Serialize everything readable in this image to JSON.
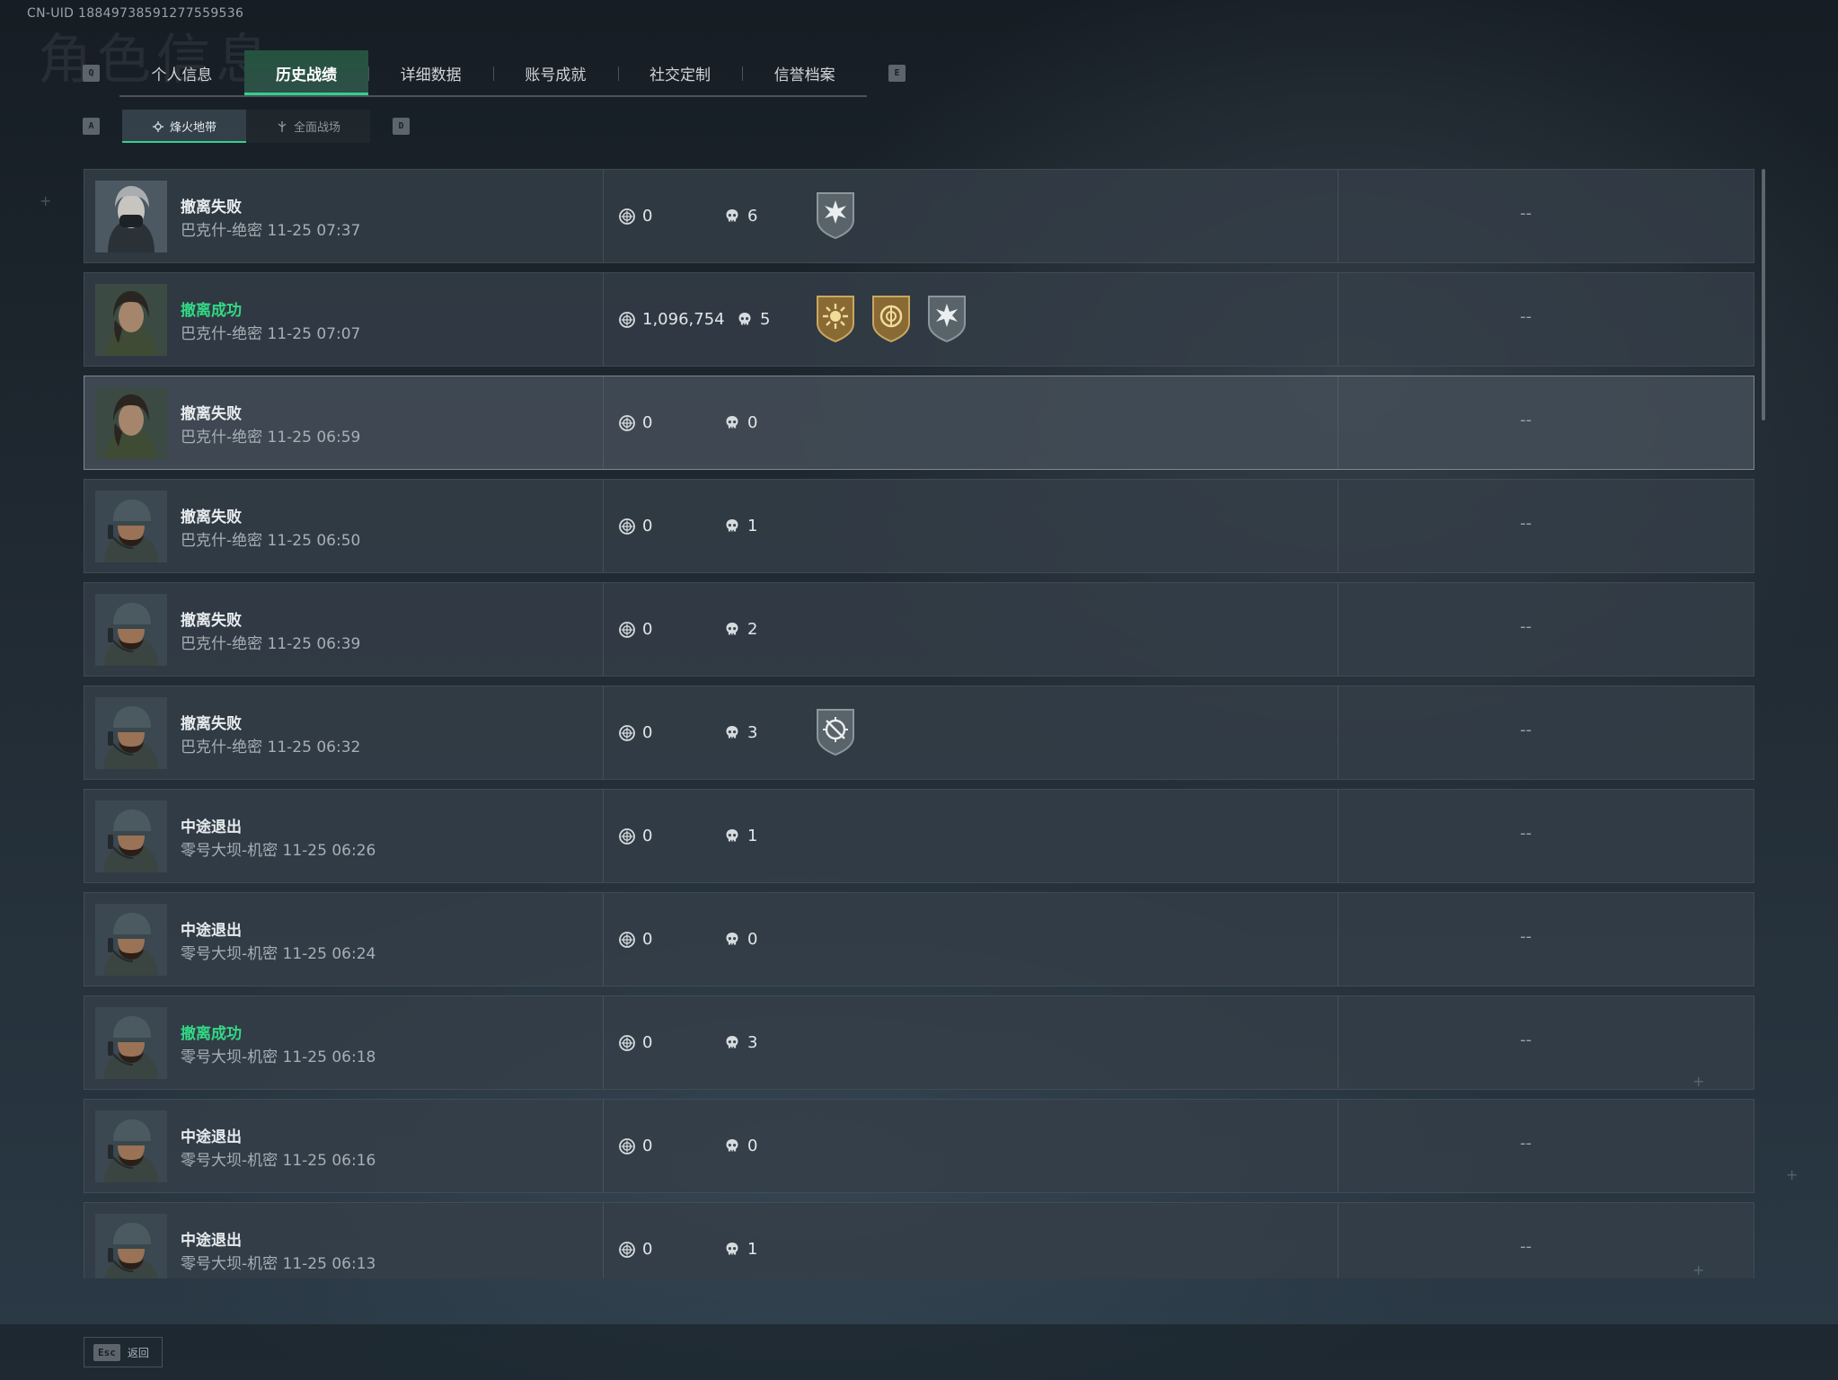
{
  "uid": "CN-UID 18849738591277559536",
  "page_title": "角色信息",
  "keys": {
    "prev_tab": "Q",
    "next_tab": "E",
    "prev_sub": "A",
    "next_sub": "D"
  },
  "tabs": [
    {
      "label": "个人信息",
      "active": false
    },
    {
      "label": "历史战绩",
      "active": true
    },
    {
      "label": "详细数据",
      "active": false
    },
    {
      "label": "账号成就",
      "active": false
    },
    {
      "label": "社交定制",
      "active": false
    },
    {
      "label": "信誉档案",
      "active": false
    }
  ],
  "subtabs": [
    {
      "label": "烽火地带",
      "icon": "flame-mode-icon",
      "active": true
    },
    {
      "label": "全面战场",
      "icon": "battlefield-mode-icon",
      "active": false
    }
  ],
  "matches": [
    {
      "result": "撤离失败",
      "success": false,
      "detail": "巴克什-绝密 11-25 07:37",
      "value": "0",
      "kills": "6",
      "badges": [
        "gray-star"
      ],
      "extra": "--",
      "avatar": "female-masked"
    },
    {
      "result": "撤离成功",
      "success": true,
      "detail": "巴克什-绝密 11-25 07:07",
      "value": "1,096,754",
      "kills": "5",
      "badges": [
        "gold-sun",
        "gold-coin",
        "gray-star"
      ],
      "extra": "--",
      "avatar": "female-dark"
    },
    {
      "result": "撤离失败",
      "success": false,
      "detail": "巴克什-绝密 11-25 06:59",
      "value": "0",
      "kills": "0",
      "badges": [],
      "extra": "--",
      "avatar": "female-dark"
    },
    {
      "result": "撤离失败",
      "success": false,
      "detail": "巴克什-绝密 11-25 06:50",
      "value": "0",
      "kills": "1",
      "badges": [],
      "extra": "--",
      "avatar": "male-cap"
    },
    {
      "result": "撤离失败",
      "success": false,
      "detail": "巴克什-绝密 11-25 06:39",
      "value": "0",
      "kills": "2",
      "badges": [],
      "extra": "--",
      "avatar": "male-cap"
    },
    {
      "result": "撤离失败",
      "success": false,
      "detail": "巴克什-绝密 11-25 06:32",
      "value": "0",
      "kills": "3",
      "badges": [
        "gray-target"
      ],
      "extra": "--",
      "avatar": "male-cap"
    },
    {
      "result": "中途退出",
      "success": false,
      "detail": "零号大坝-机密 11-25 06:26",
      "value": "0",
      "kills": "1",
      "badges": [],
      "extra": "--",
      "avatar": "male-cap"
    },
    {
      "result": "中途退出",
      "success": false,
      "detail": "零号大坝-机密 11-25 06:24",
      "value": "0",
      "kills": "0",
      "badges": [],
      "extra": "--",
      "avatar": "male-cap"
    },
    {
      "result": "撤离成功",
      "success": true,
      "detail": "零号大坝-机密 11-25 06:18",
      "value": "0",
      "kills": "3",
      "badges": [],
      "extra": "--",
      "avatar": "male-cap"
    },
    {
      "result": "中途退出",
      "success": false,
      "detail": "零号大坝-机密 11-25 06:16",
      "value": "0",
      "kills": "0",
      "badges": [],
      "extra": "--",
      "avatar": "male-cap"
    },
    {
      "result": "中途退出",
      "success": false,
      "detail": "零号大坝-机密 11-25 06:13",
      "value": "0",
      "kills": "1",
      "badges": [],
      "extra": "--",
      "avatar": "male-cap"
    }
  ],
  "footer": {
    "esc_key": "Esc",
    "back_label": "返回"
  },
  "colors": {
    "accent": "#33d18c",
    "success_text": "#32d985"
  }
}
